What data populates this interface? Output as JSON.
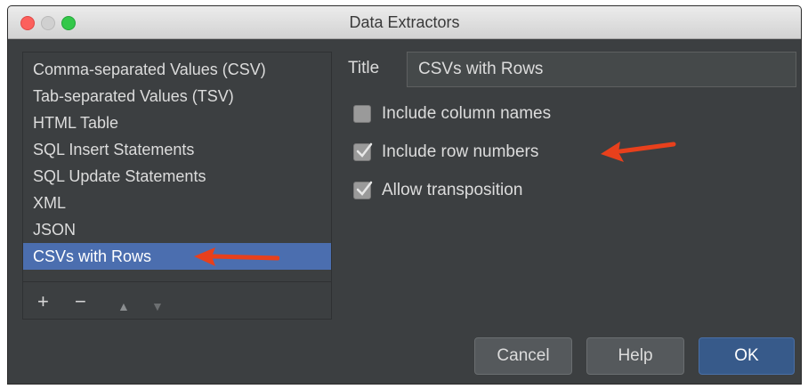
{
  "window": {
    "title": "Data Extractors"
  },
  "extractor_list": {
    "items": [
      "Comma-separated Values (CSV)",
      "Tab-separated Values (TSV)",
      "HTML Table",
      "SQL Insert Statements",
      "SQL Update Statements",
      "XML",
      "JSON",
      "CSVs with Rows"
    ],
    "selected_index": 7,
    "toolbar": {
      "add": "+",
      "remove": "−",
      "move_up": "▲",
      "move_down": "▼"
    }
  },
  "settings": {
    "title_label": "Title",
    "title_value": "CSVs with Rows",
    "options": [
      {
        "label": "Include column names",
        "checked": false
      },
      {
        "label": "Include row numbers",
        "checked": true
      },
      {
        "label": "Allow transposition",
        "checked": true
      }
    ]
  },
  "buttons": {
    "cancel": "Cancel",
    "help": "Help",
    "ok": "OK"
  },
  "colors": {
    "accent": "#4b6eaf",
    "annotation_arrow": "#e8401c"
  }
}
